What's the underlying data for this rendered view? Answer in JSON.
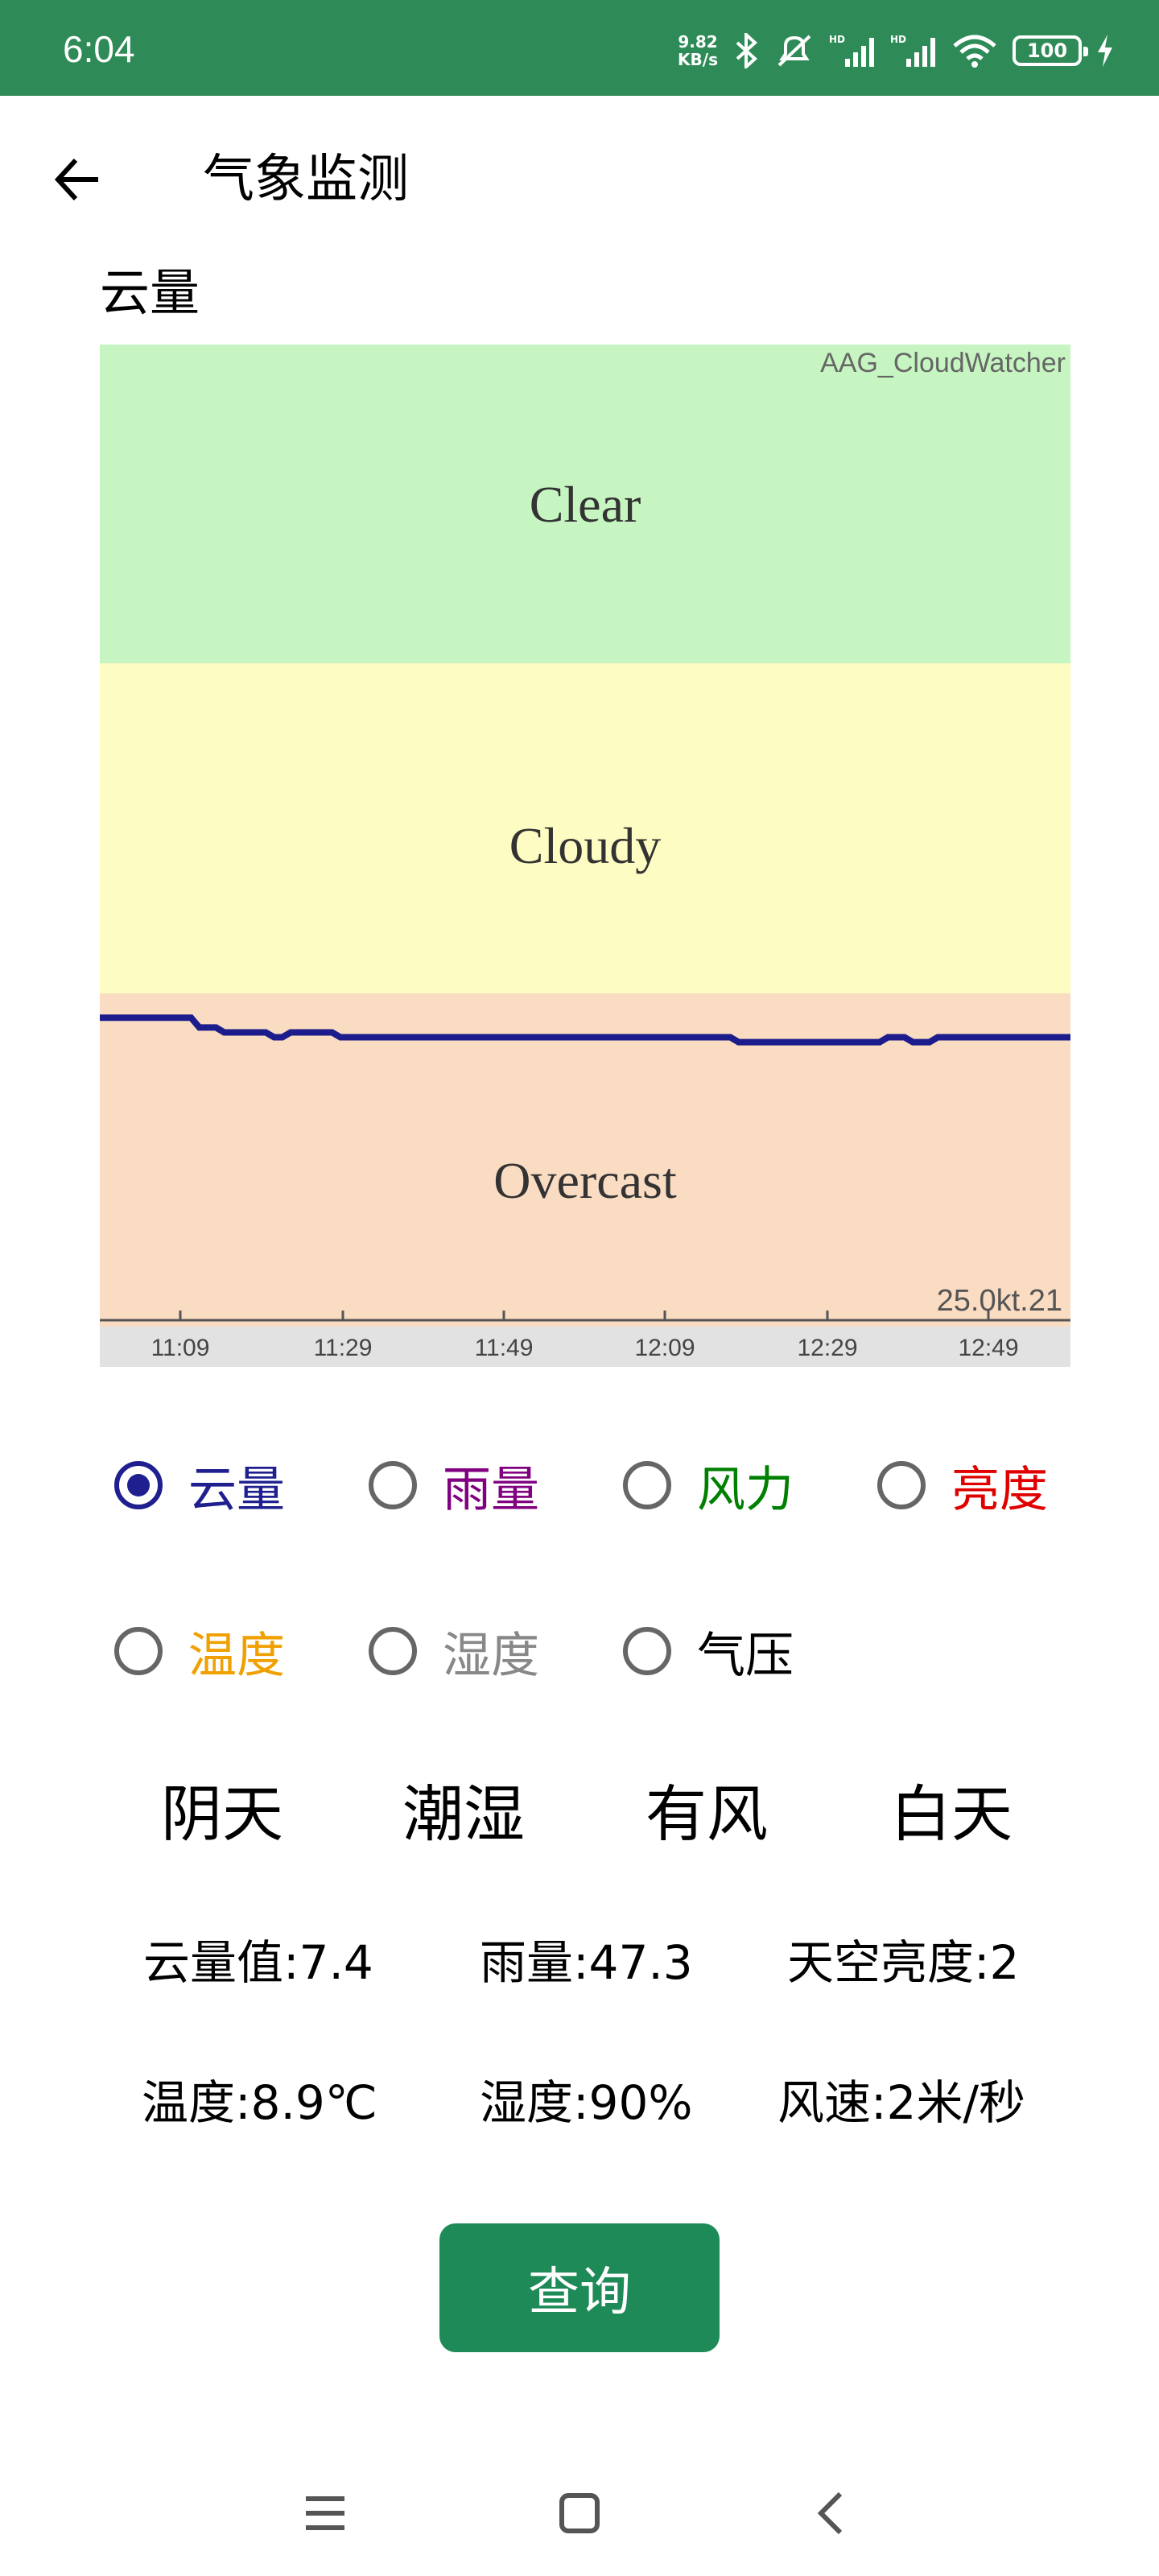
{
  "status_bar": {
    "time": "6:04",
    "net_speed_value": "9.82",
    "net_speed_unit": "KB/s",
    "battery": "100",
    "icons": [
      "bluetooth-icon",
      "mute-icon",
      "hd-signal-icon",
      "hd-signal-icon",
      "wifi-icon",
      "battery-icon",
      "charging-icon"
    ]
  },
  "app_bar": {
    "title": "气象监测",
    "back_icon": "arrow-left-icon"
  },
  "section_label": "云量",
  "chart_data": {
    "type": "line",
    "watermark": "AAG_CloudWatcher",
    "date_label": "25.0kt.21",
    "bands": [
      {
        "label": "Clear",
        "color": "#c6f5c2"
      },
      {
        "label": "Cloudy",
        "color": "#fdfcc2"
      },
      {
        "label": "Overcast",
        "color": "#f9dcc2"
      }
    ],
    "x_ticks": [
      "11:09",
      "11:29",
      "11:49",
      "12:09",
      "12:29",
      "12:49"
    ],
    "series": [
      {
        "color": "#1c1c8c",
        "values": [
          0.31,
          0.31,
          0.31,
          0.31,
          0.31,
          0.31,
          0.31,
          0.31,
          0.31,
          0.31,
          0.31,
          0.31,
          0.3,
          0.3,
          0.3,
          0.295,
          0.295,
          0.295,
          0.295,
          0.295,
          0.295,
          0.29,
          0.29,
          0.295,
          0.295,
          0.295,
          0.295,
          0.295,
          0.295,
          0.29,
          0.29,
          0.29,
          0.29,
          0.29,
          0.29,
          0.29,
          0.29,
          0.29,
          0.29,
          0.29,
          0.29,
          0.29,
          0.29,
          0.29,
          0.29,
          0.29,
          0.29,
          0.29,
          0.29,
          0.29,
          0.29,
          0.29,
          0.29,
          0.29,
          0.29,
          0.29,
          0.29,
          0.29,
          0.29,
          0.29,
          0.29,
          0.29,
          0.29,
          0.29,
          0.29,
          0.29,
          0.29,
          0.29,
          0.29,
          0.29,
          0.29,
          0.29,
          0.29,
          0.29,
          0.29,
          0.29,
          0.29,
          0.285,
          0.285,
          0.285,
          0.285,
          0.285,
          0.285,
          0.285,
          0.285,
          0.285,
          0.285,
          0.285,
          0.285,
          0.285,
          0.285,
          0.285,
          0.285,
          0.285,
          0.285,
          0.29,
          0.29,
          0.29,
          0.285,
          0.285,
          0.285,
          0.29,
          0.29,
          0.29,
          0.29,
          0.29,
          0.29,
          0.29,
          0.29,
          0.29,
          0.29,
          0.29,
          0.29,
          0.29,
          0.29,
          0.29,
          0.29,
          0.29
        ]
      }
    ]
  },
  "radios_row1": [
    {
      "label": "云量",
      "color": "#1f1f8f",
      "checked": true
    },
    {
      "label": "雨量",
      "color": "#800080",
      "checked": false
    },
    {
      "label": "风力",
      "color": "#008000",
      "checked": false
    },
    {
      "label": "亮度",
      "color": "#e00000",
      "checked": false
    }
  ],
  "radios_row2": [
    {
      "label": "温度",
      "color": "#f0a000",
      "checked": false
    },
    {
      "label": "湿度",
      "color": "#888888",
      "checked": false
    },
    {
      "label": "气压",
      "color": "#000000",
      "checked": false
    }
  ],
  "status_words": [
    "阴天",
    "潮湿",
    "有风",
    "白天"
  ],
  "values_row1": [
    "云量值:7.4",
    "雨量:47.3",
    "天空亮度:2"
  ],
  "values_row2": [
    "温度:8.9℃",
    "湿度:90%",
    "风速:2米/秒"
  ],
  "query_button": "查询",
  "nav_bar": {
    "icons": [
      "menu-icon",
      "home-square-icon",
      "back-chevron-icon"
    ]
  }
}
